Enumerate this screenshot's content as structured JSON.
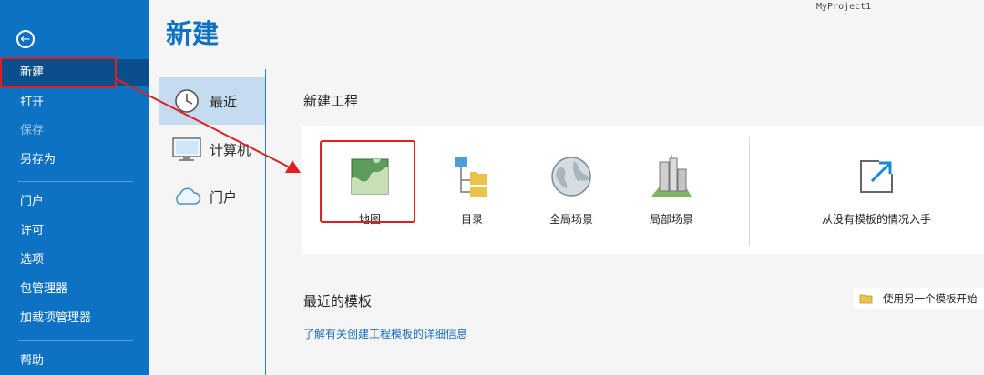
{
  "window": {
    "project_name": "MyProject1"
  },
  "sidebar": {
    "items": [
      {
        "label": "新建"
      },
      {
        "label": "打开"
      },
      {
        "label": "保存"
      },
      {
        "label": "另存为"
      },
      {
        "label": "门户"
      },
      {
        "label": "许可"
      },
      {
        "label": "选项"
      },
      {
        "label": "包管理器"
      },
      {
        "label": "加载项管理器"
      },
      {
        "label": "帮助"
      }
    ]
  },
  "page": {
    "title": "新建"
  },
  "locations": [
    {
      "label": "最近",
      "icon": "clock-icon"
    },
    {
      "label": "计算机",
      "icon": "computer-icon"
    },
    {
      "label": "门户",
      "icon": "cloud-icon"
    }
  ],
  "new_project": {
    "section_title": "新建工程",
    "templates": [
      {
        "label": "地图",
        "icon": "map-icon"
      },
      {
        "label": "目录",
        "icon": "catalog-icon"
      },
      {
        "label": "全局场景",
        "icon": "globe-icon"
      },
      {
        "label": "局部场景",
        "icon": "local-scene-icon"
      }
    ],
    "start_without_template": "从没有模板的情况入手"
  },
  "recent_templates": {
    "section_title": "最近的模板",
    "learn_more_link": "了解有关创建工程模板的详细信息",
    "start_another_template": "使用另一个模板开始"
  },
  "colors": {
    "accent": "#0d72c4",
    "highlight": "#e02020",
    "selected": "#c5dcf0"
  }
}
